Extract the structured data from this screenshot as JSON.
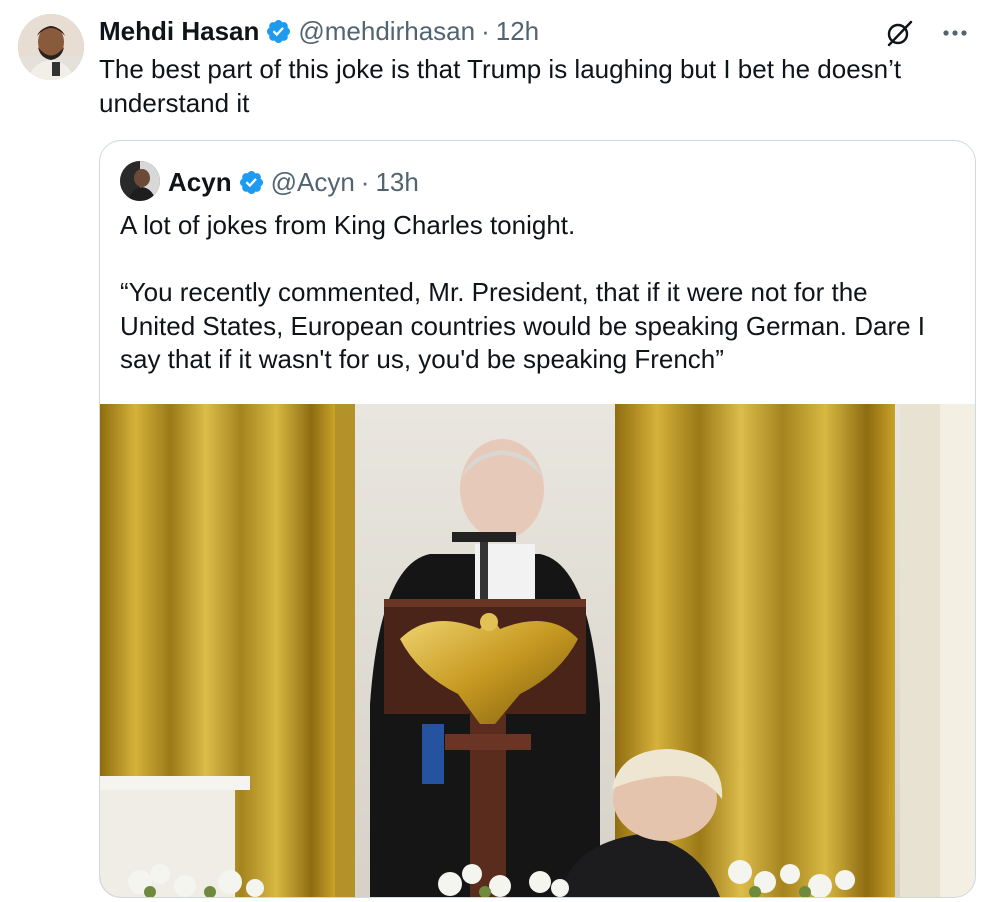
{
  "tweet": {
    "author_name": "Mehdi Hasan",
    "handle": "@mehdirhasan",
    "separator": "·",
    "time": "12h",
    "text": "The best part of this joke is that Trump is laughing but I bet he doesn’t understand it",
    "more_label": "···"
  },
  "quoted_tweet": {
    "author_name": "Acyn",
    "handle": "@Acyn",
    "separator": "·",
    "time": "13h",
    "paragraphs": [
      "A lot of jokes from King Charles tonight.",
      "“You recently commented, Mr. President, that if it were not for the United States, European countries would be speaking German. Dare I say that if it wasn't for us, you'd be speaking French”"
    ]
  },
  "icons": {
    "verified": "verified-badge-icon",
    "grok": "grok-icon",
    "more": "more-options-icon"
  },
  "colors": {
    "verified": "#1d9bf0",
    "text": "#0f1419",
    "muted": "#536471",
    "border": "#cfd9de",
    "curtain_gold": "#c9a227"
  }
}
